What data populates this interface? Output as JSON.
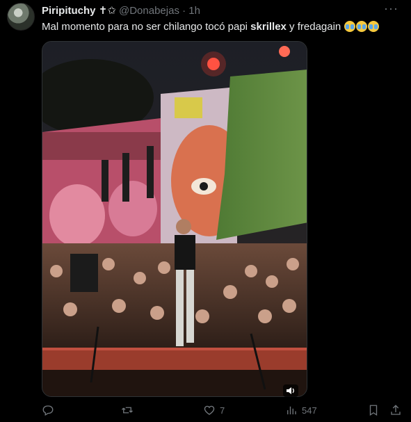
{
  "author": {
    "display_name": "Piripituchy",
    "badge_icons": "✝✩",
    "handle": "@Donabejas",
    "separator": "·",
    "time": "1h"
  },
  "tweet": {
    "text_before": "Mal momento para no ser chilango tocó papi ",
    "bold": "skrillex",
    "text_after": " y fredagain",
    "emoji": [
      "loudly-crying-face",
      "loudly-crying-face",
      "loudly-crying-face"
    ]
  },
  "media": {
    "type": "video",
    "has_sound_icon": true
  },
  "actions": {
    "reply": {
      "icon": "reply-icon",
      "count": ""
    },
    "repost": {
      "icon": "repost-icon",
      "count": ""
    },
    "like": {
      "icon": "heart-icon",
      "count": "7"
    },
    "views": {
      "icon": "views-icon",
      "count": "547"
    },
    "bookmark": {
      "icon": "bookmark-icon"
    },
    "share": {
      "icon": "share-icon"
    }
  },
  "more_icon": "···"
}
